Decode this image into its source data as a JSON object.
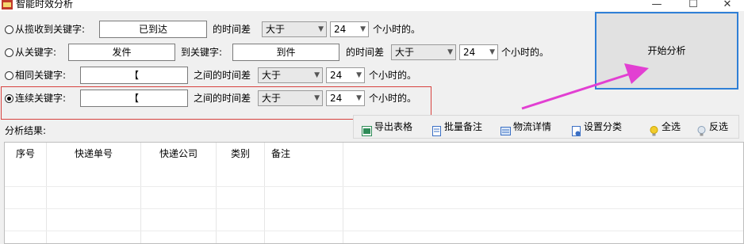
{
  "window": {
    "title": "智能时效分析",
    "controls": {
      "minimize": "—",
      "maximize": "☐",
      "close": "✕"
    }
  },
  "rows": [
    {
      "label": "从揽收到关键字:",
      "keyword": "已到达",
      "diff_label": "的时间差",
      "compare": "大于",
      "hours": "24",
      "unit": "个小时的。",
      "checked": false
    },
    {
      "label": "从关键字:",
      "from_keyword": "发件",
      "to_label": "到关键字:",
      "to_keyword": "到件",
      "diff_label": "的时间差",
      "compare": "大于",
      "hours": "24",
      "unit": "个小时的。",
      "checked": false
    },
    {
      "label": "相同关键字:",
      "keyword": "【",
      "diff_label": "之间的时间差",
      "compare": "大于",
      "hours": "24",
      "unit": "个小时的。",
      "checked": false
    },
    {
      "label": "连续关键字:",
      "keyword": "【",
      "diff_label": "之间的时间差",
      "compare": "大于",
      "hours": "24",
      "unit": "个小时的。",
      "checked": true
    }
  ],
  "start_button": "开始分析",
  "results_label": "分析结果:",
  "toolbar": [
    {
      "label": "导出表格",
      "icon": "excel-export-icon",
      "color": "#2e8b57"
    },
    {
      "label": "批量备注",
      "icon": "batch-note-icon",
      "color": "#3a6fc4"
    },
    {
      "label": "物流详情",
      "icon": "logistics-detail-icon",
      "color": "#3a6fc4"
    },
    {
      "label": "设置分类",
      "icon": "category-settings-icon",
      "color": "#3a6fc4"
    },
    {
      "label": "全选",
      "icon": "select-all-bulb-icon",
      "color": "#e6b800"
    },
    {
      "label": "反选",
      "icon": "invert-select-bulb-icon",
      "color": "#8aa0b8"
    }
  ],
  "table": {
    "columns": [
      "序号",
      "快递单号",
      "快递公司",
      "类别",
      "备注"
    ]
  },
  "accent": {
    "highlight": "#d7423f",
    "arrow": "#e23fd2",
    "button_border": "#2f7fd6"
  }
}
